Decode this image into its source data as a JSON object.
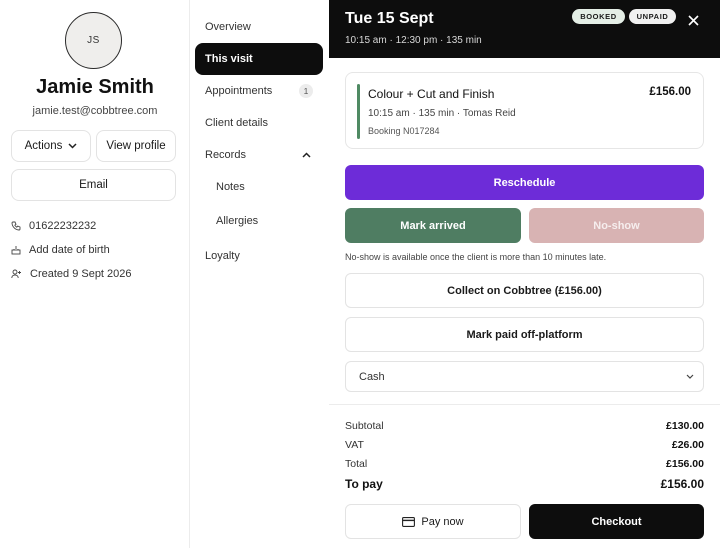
{
  "client": {
    "initials": "JS",
    "name": "Jamie Smith",
    "email": "jamie.test@cobbtree.com",
    "actions_label": "Actions",
    "view_profile_label": "View profile",
    "email_button_label": "Email",
    "phone": "01622232232",
    "dob": "Add date of birth",
    "created": "Created 9 Sept 2026"
  },
  "nav": {
    "overview": "Overview",
    "this_visit": "This visit",
    "appointments": "Appointments",
    "appointments_count": "1",
    "client_details": "Client details",
    "records": "Records",
    "notes": "Notes",
    "allergies": "Allergies",
    "loyalty": "Loyalty"
  },
  "visit": {
    "date": "Tue 15 Sept",
    "time": "10:15 am · 12:30 pm · 135 min",
    "status_booked": "BOOKED",
    "status_unpaid": "UNPAID",
    "service": {
      "name": "Colour + Cut and Finish",
      "price": "£156.00",
      "meta": "10:15 am · 135 min · Tomas Reid",
      "booking_ref": "Booking N017284"
    },
    "reschedule_label": "Reschedule",
    "mark_arrived_label": "Mark arrived",
    "no_show_label": "No-show",
    "no_show_hint": "No-show is available once the client is more than 10 minutes late.",
    "collect_label": "Collect on Cobbtree (£156.00)",
    "mark_paid_label": "Mark paid off-platform",
    "payment_method": "Cash"
  },
  "summary": {
    "subtotal_label": "Subtotal",
    "subtotal": "£130.00",
    "vat_label": "VAT",
    "vat": "£26.00",
    "total_label": "Total",
    "total": "£156.00",
    "to_pay_label": "To pay",
    "to_pay": "£156.00"
  },
  "footer": {
    "pay_now_label": "Pay now",
    "checkout_label": "Checkout"
  },
  "colors": {
    "accent_purple": "#6d2cd8",
    "arrived_green": "#4f7d62",
    "no_show_disabled": "#d8b3b3",
    "header_black": "#0d0d0d"
  }
}
